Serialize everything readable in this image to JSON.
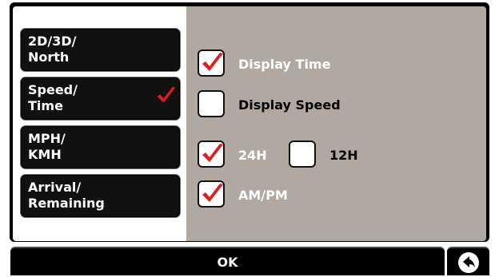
{
  "menu": {
    "items": [
      {
        "line1": "2D/3D/",
        "line2": "North",
        "selected": false
      },
      {
        "line1": "Speed/",
        "line2": "Time",
        "selected": true
      },
      {
        "line1": "MPH/",
        "line2": "KMH",
        "selected": false
      },
      {
        "line1": "Arrival/",
        "line2": "Remaining",
        "selected": false
      }
    ]
  },
  "options": {
    "display_time": {
      "label": "Display Time",
      "checked": true
    },
    "display_speed": {
      "label": "Display Speed",
      "checked": false
    },
    "format_24h": {
      "label": "24H",
      "checked": true
    },
    "format_12h": {
      "label": "12H",
      "checked": false
    },
    "am_pm": {
      "label": "AM/PM",
      "checked": true
    }
  },
  "footer": {
    "ok_label": "OK",
    "back_icon": "back-arrow-icon"
  },
  "colors": {
    "check": "#e8191c",
    "panel_right": "#b2a8a2",
    "menu_button": "#111111"
  }
}
